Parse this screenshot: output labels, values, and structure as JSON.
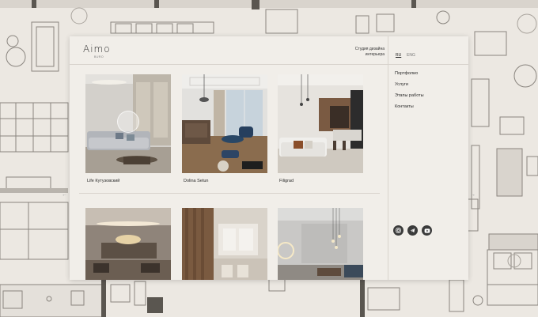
{
  "brand": {
    "name": "Aimo",
    "sub": "BURO"
  },
  "tagline": "Студия дизайна интерьера",
  "lang": {
    "ru": "RU",
    "en": "ENG"
  },
  "nav": [
    {
      "label": "Портфолио"
    },
    {
      "label": "Услуги"
    },
    {
      "label": "Этапы работы"
    },
    {
      "label": "Контакты"
    }
  ],
  "projects": [
    {
      "title": "Life Кутузовский"
    },
    {
      "title": "Dolina Setun"
    },
    {
      "title": "Filigrad"
    }
  ],
  "social": [
    {
      "icon": "instagram-icon"
    },
    {
      "icon": "telegram-icon"
    },
    {
      "icon": "youtube-icon"
    }
  ],
  "colors": {
    "background": "#ece8e2",
    "panel": "#f1eee9",
    "icon": "#3b3b3b"
  }
}
